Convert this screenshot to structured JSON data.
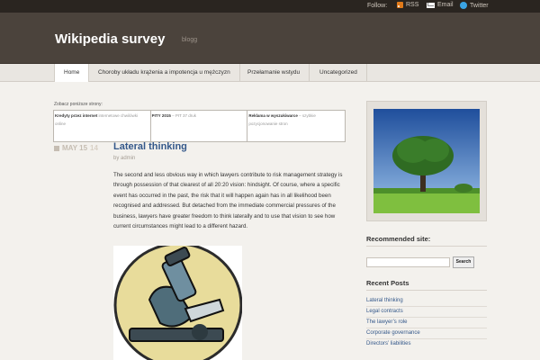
{
  "topbar": {
    "follow_label": "Follow:",
    "links": [
      {
        "label": "RSS",
        "icon": "rss-icon"
      },
      {
        "label": "Email",
        "icon": "email-icon"
      },
      {
        "label": "Twitter",
        "icon": "twitter-icon"
      }
    ]
  },
  "header": {
    "title": "Wikipedia survey",
    "tagline": "blogg"
  },
  "nav": {
    "items": [
      "Home",
      "Choroby układu krążenia a impotencja u mężczyzn",
      "Przełamanie wstydu",
      "Uncategorized"
    ],
    "active": "Home"
  },
  "pages": {
    "label": "Zobacz poniższe strony:",
    "cells": [
      {
        "bold": "Kredyty przez internet",
        "text": "internetowe chwilówki online"
      },
      {
        "bold": "PITY 2015",
        "text": "– PIT 37 druk"
      },
      {
        "bold": "Reklama w wyszukiwarce",
        "text": "– szybkie pozycjonowanie stron"
      }
    ]
  },
  "post": {
    "date": "MAY 15",
    "year": "14",
    "title": "Lateral thinking",
    "author": "by admin",
    "body": "The second and less obvious way in which lawyers contribute to risk management strategy is through possession of that clearest of all 20:20 vision: hindsight. Of course, where a specific event has occurred in the past, the risk that it will happen again has in all likelihood been recognised and addressed. But detached from the immediate commercial pressures of the business, lawyers have greater freedom to think laterally and to use that vision to see how current circumstances might lead to a different hazard."
  },
  "sidebar": {
    "recommended_title": "Recommended site:",
    "search_button": "Search",
    "search_placeholder": "",
    "recent_title": "Recent Posts",
    "recent_posts": [
      "Lateral thinking",
      "Legal contracts",
      "The lawyer’s role",
      "Corporate governance",
      "Directors’ liabilities"
    ]
  },
  "colors": {
    "header_bg": "#4b433c",
    "topbar_bg": "#2a2520",
    "link": "#34588a",
    "page_bg": "#f3f1ed"
  }
}
